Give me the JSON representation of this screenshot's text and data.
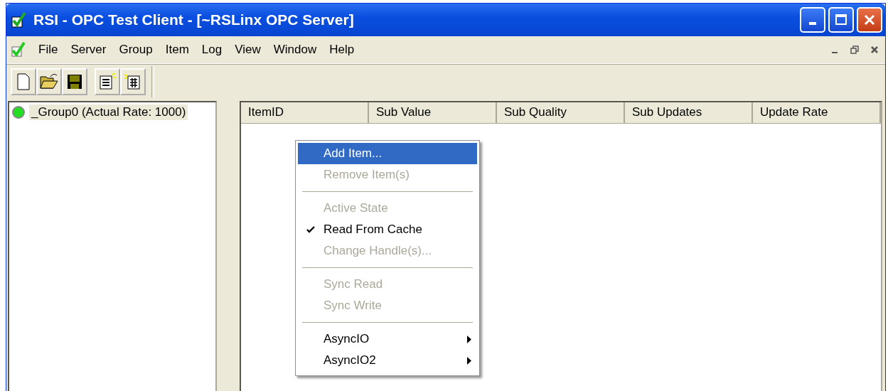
{
  "window": {
    "title": "RSI - OPC Test Client - [~RSLinx OPC Server]"
  },
  "menu_bar": [
    "File",
    "Server",
    "Group",
    "Item",
    "Log",
    "View",
    "Window",
    "Help"
  ],
  "tree": [
    {
      "label": "_Group0 (Actual Rate: 1000)",
      "selected": true,
      "active": true
    }
  ],
  "table": {
    "columns": [
      "ItemID",
      "Sub Value",
      "Sub Quality",
      "Sub Updates",
      "Update Rate"
    ]
  },
  "context_menu": [
    {
      "kind": "item",
      "label": "Add Item...",
      "selected": true,
      "disabled": false,
      "checked": false,
      "submenu": false
    },
    {
      "kind": "item",
      "label": "Remove Item(s)",
      "selected": false,
      "disabled": true,
      "checked": false,
      "submenu": false
    },
    {
      "kind": "separator"
    },
    {
      "kind": "item",
      "label": "Active State",
      "selected": false,
      "disabled": true,
      "checked": false,
      "submenu": false
    },
    {
      "kind": "item",
      "label": "Read From Cache",
      "selected": false,
      "disabled": false,
      "checked": true,
      "submenu": false
    },
    {
      "kind": "item",
      "label": "Change Handle(s)...",
      "selected": false,
      "disabled": true,
      "checked": false,
      "submenu": false
    },
    {
      "kind": "separator"
    },
    {
      "kind": "item",
      "label": "Sync Read",
      "selected": false,
      "disabled": true,
      "checked": false,
      "submenu": false
    },
    {
      "kind": "item",
      "label": "Sync Write",
      "selected": false,
      "disabled": true,
      "checked": false,
      "submenu": false
    },
    {
      "kind": "separator"
    },
    {
      "kind": "item",
      "label": "AsyncIO",
      "selected": false,
      "disabled": false,
      "checked": false,
      "submenu": true
    },
    {
      "kind": "item",
      "label": "AsyncIO2",
      "selected": false,
      "disabled": false,
      "checked": false,
      "submenu": true
    }
  ]
}
